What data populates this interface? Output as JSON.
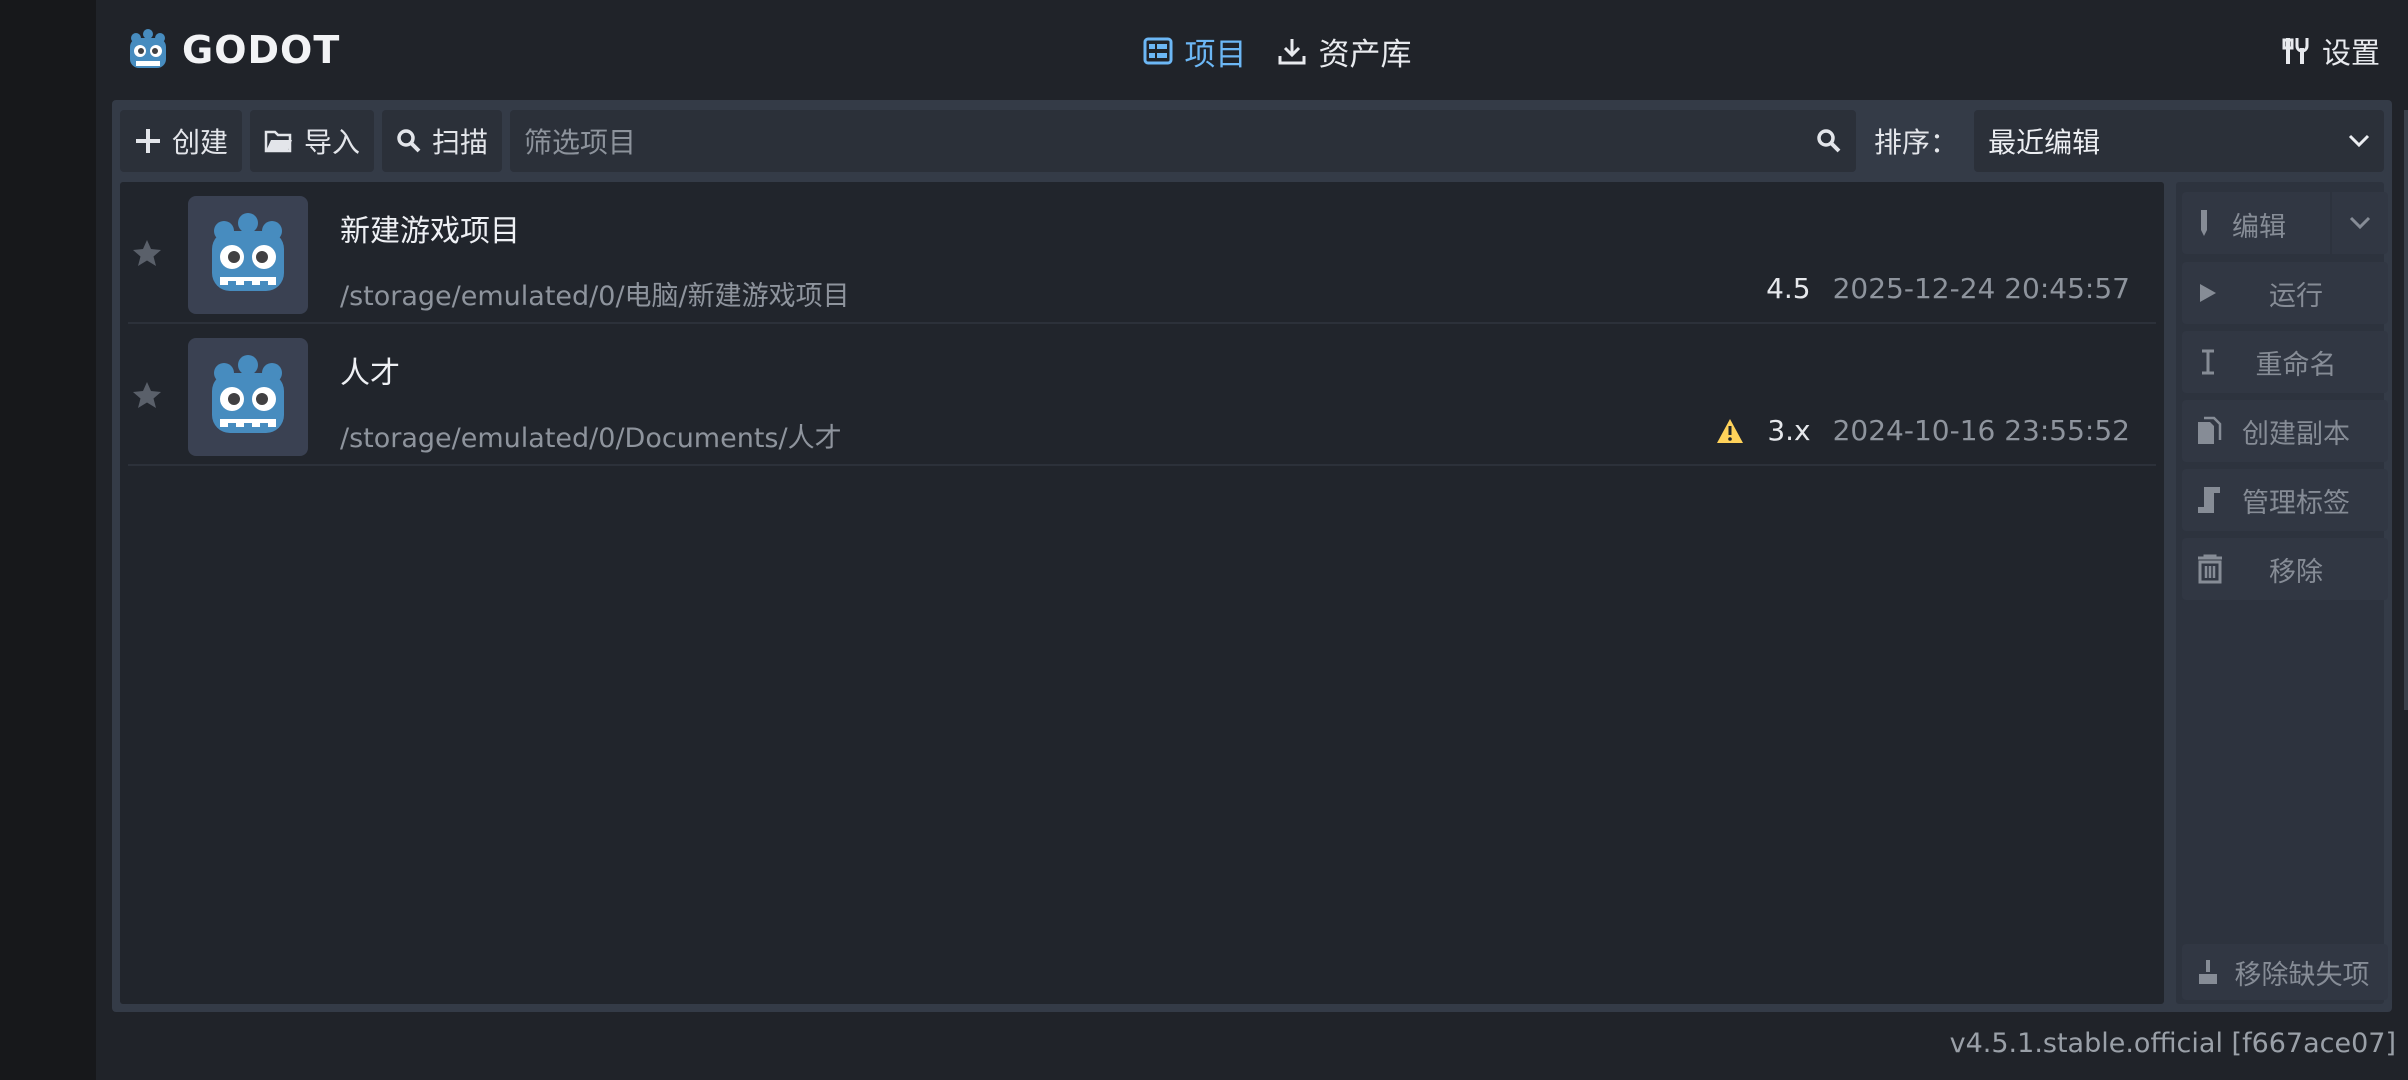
{
  "app": {
    "logo_text": "GODOT"
  },
  "tabs": [
    {
      "label": "项目",
      "active": true
    },
    {
      "label": "资产库",
      "active": false
    }
  ],
  "settings_label": "设置",
  "toolbar": {
    "create": "创建",
    "import": "导入",
    "scan": "扫描",
    "filter_placeholder": "筛选项目",
    "sort_label": "排序：",
    "sort_value": "最近编辑"
  },
  "projects": [
    {
      "name": "新建游戏项目",
      "path": "/storage/emulated/0/电脑/新建游戏项目",
      "version": "4.5",
      "warning": false,
      "date": "2025-12-24 20:45:57"
    },
    {
      "name": "人才",
      "path": "/storage/emulated/0/Documents/人才",
      "version": "3.x",
      "warning": true,
      "date": "2024-10-16 23:55:52"
    }
  ],
  "side_buttons": {
    "edit": "编辑",
    "run": "运行",
    "rename": "重命名",
    "duplicate": "创建副本",
    "manage_tags": "管理标签",
    "remove": "移除",
    "remove_missing": "移除缺失项"
  },
  "version_text": "v4.5.1.stable.official [f667ace07]",
  "colors": {
    "accent": "#6cb7f5",
    "warning": "#ffd25a",
    "godot_blue": "#478cbf"
  }
}
